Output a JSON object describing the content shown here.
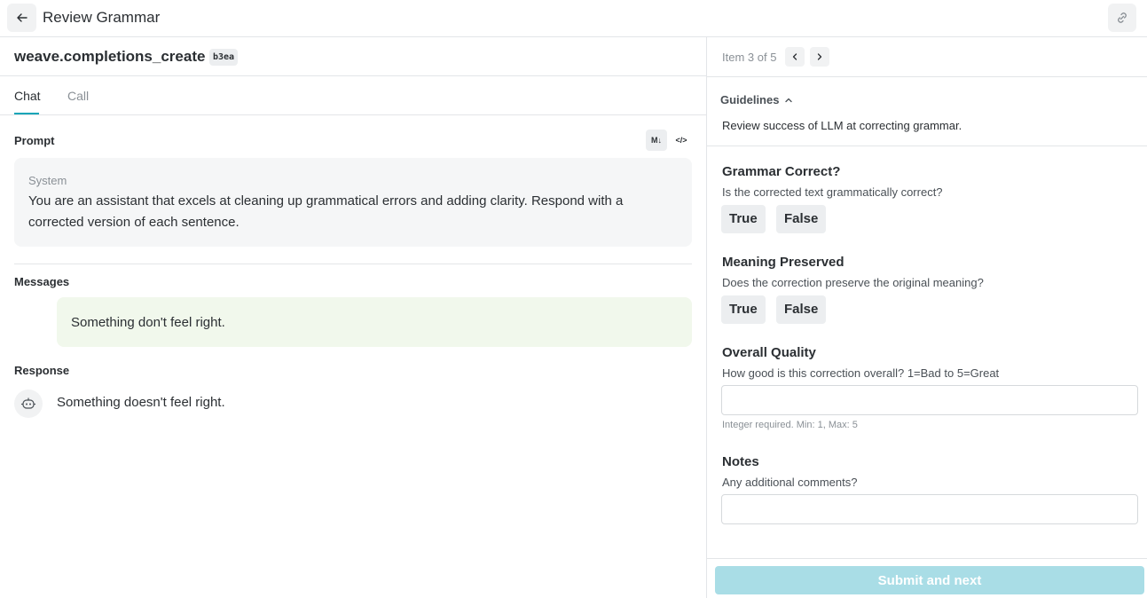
{
  "header": {
    "title": "Review Grammar"
  },
  "call": {
    "name": "weave.completions_create",
    "badge": "b3ea"
  },
  "tabs": [
    {
      "label": "Chat",
      "active": true
    },
    {
      "label": "Call",
      "active": false
    }
  ],
  "prompt": {
    "label": "Prompt",
    "markdown_toggle": "M↓",
    "code_toggle": "</>",
    "system_role": "System",
    "system_text": "You are an assistant that excels at cleaning up grammatical errors and adding clarity. Respond with a corrected version of each sentence."
  },
  "messages": {
    "label": "Messages",
    "user_text": "Something don't feel right."
  },
  "response": {
    "label": "Response",
    "text": "Something doesn't feel right."
  },
  "review": {
    "item_counter": "Item 3 of 5",
    "guidelines_label": "Guidelines",
    "guidelines_text": "Review success of LLM at correcting grammar.",
    "questions": [
      {
        "title": "Grammar Correct?",
        "description": "Is the corrected text grammatically correct?",
        "options": [
          "True",
          "False"
        ]
      },
      {
        "title": "Meaning Preserved",
        "description": "Does the correction preserve the original meaning?",
        "options": [
          "True",
          "False"
        ]
      },
      {
        "title": "Overall Quality",
        "description": "How good is this correction overall? 1=Bad to 5=Great",
        "value": "",
        "hint": "Integer required. Min: 1, Max: 5"
      },
      {
        "title": "Notes",
        "description": "Any additional comments?",
        "value": ""
      }
    ],
    "submit_label": "Submit and next"
  },
  "colors": {
    "accent": "#10a5b8",
    "submit_disabled": "#a9dde6",
    "user_message_bg": "#f1f8ec"
  },
  "icons": [
    "arrow-left-icon",
    "link-icon",
    "chevron-left-icon",
    "chevron-right-icon",
    "chevron-up-icon",
    "robot-icon"
  ]
}
